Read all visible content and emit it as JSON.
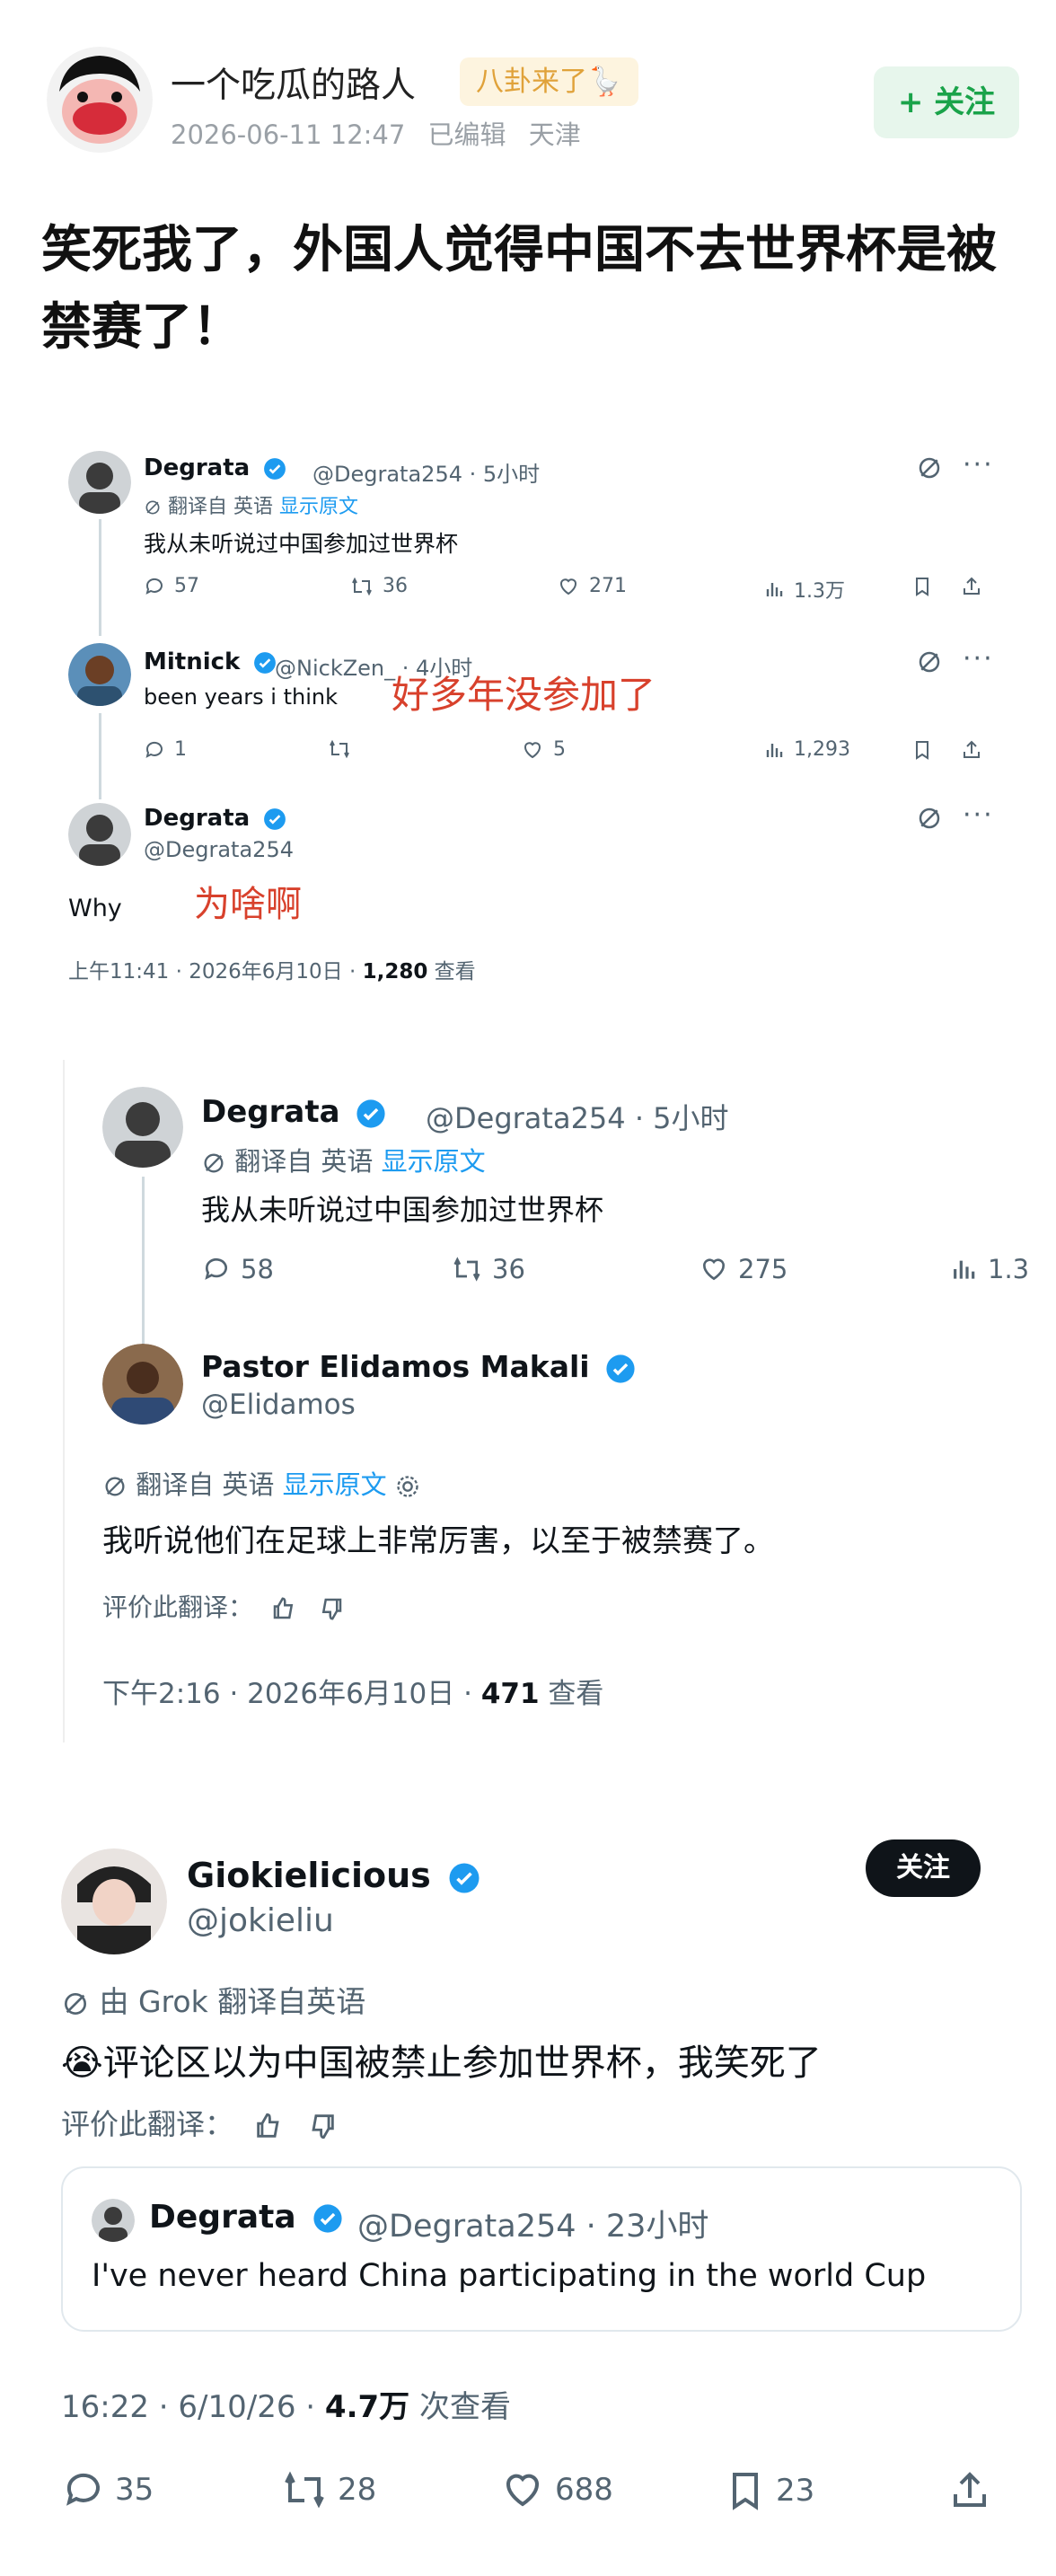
{
  "post": {
    "author": "一个吃瓜的路人",
    "tag": "八卦来了🪿",
    "date": "2026-06-11 12:47",
    "edited": "已编辑",
    "location": "天津",
    "follow_label": "+ 关注",
    "title": "笑死我了，外国人觉得中国不去世界杯是被禁赛了！"
  },
  "shot1": {
    "t1": {
      "name": "Degrata",
      "handle": "@Degrata254 · 5小时",
      "translate": "翻译自 英语",
      "show_original": "显示原文",
      "text": "我从未听说过中国参加过世界杯",
      "replies": "57",
      "retweets": "36",
      "likes": "271",
      "views": "1.3万"
    },
    "t2": {
      "name": "Mitnick",
      "handle": "@NickZen_ · 4小时",
      "text": "been years i think",
      "annotation": "好多年没参加了",
      "replies": "1",
      "retweets": "",
      "likes": "5",
      "views": "1,293"
    },
    "t3": {
      "name": "Degrata",
      "handle": "@Degrata254",
      "text": "Why",
      "annotation": "为啥啊",
      "footer_time": "上午11:41 · 2026年6月10日 · ",
      "footer_views": "1,280",
      "footer_views_label": " 查看"
    }
  },
  "shot2": {
    "t1": {
      "name": "Degrata",
      "handle": "@Degrata254 · 5小时",
      "translate": "翻译自 英语",
      "show_original": "显示原文",
      "text": "我从未听说过中国参加过世界杯",
      "replies": "58",
      "retweets": "36",
      "likes": "275",
      "views": "1.3"
    },
    "t2": {
      "name": "Pastor Elidamos Makali",
      "handle": "@Elidamos",
      "translate": "翻译自 英语",
      "show_original": "显示原文",
      "text": "我听说他们在足球上非常厉害，以至于被禁赛了。",
      "rate": "评价此翻译：",
      "footer_time": "下午2:16 · 2026年6月10日 · ",
      "footer_views": "471",
      "footer_views_label": " 查看"
    }
  },
  "shot3": {
    "name": "Giokielicious",
    "handle": "@jokieliu",
    "follow_label": "关注",
    "translate": "由 Grok 翻译自英语",
    "text": "😭评论区以为中国被禁止参加世界杯，我笑死了",
    "rate": "评价此翻译：",
    "quote": {
      "name": "Degrata",
      "handle": "@Degrata254 · 23小时",
      "text": "I've never heard China participating in the world Cup"
    },
    "footer_time": "16:22 · 6/10/26 · ",
    "footer_views": "4.7万",
    "footer_views_label": " 次查看",
    "replies": "35",
    "retweets": "28",
    "likes": "688",
    "bookmarks": "23"
  },
  "colors": {
    "accent_blue": "#1d9bf0",
    "follow_green": "#1aa34a",
    "annotation_red": "#d8412c",
    "tag_orange": "#e0a23a"
  }
}
